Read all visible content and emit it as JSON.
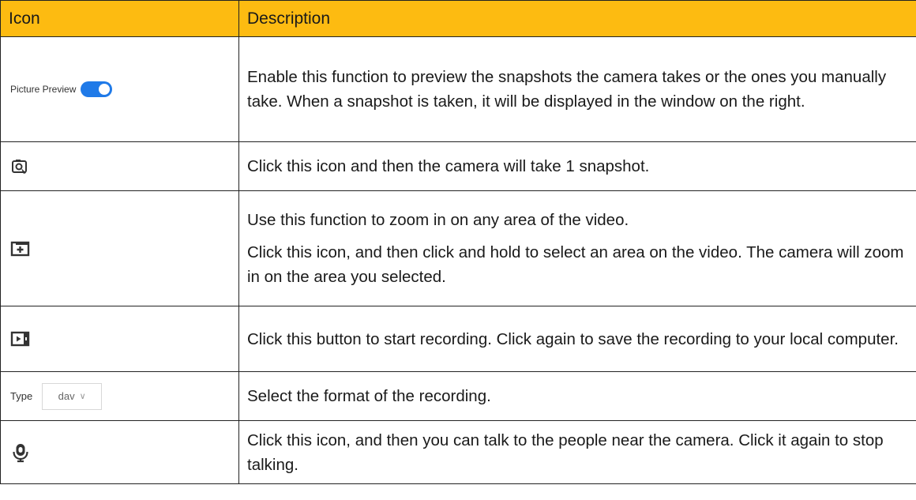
{
  "table": {
    "headers": {
      "icon": "Icon",
      "description": "Description"
    },
    "rows": [
      {
        "icon": "picture-preview-toggle",
        "widget_label": "Picture Preview",
        "widget_state": "on",
        "description": [
          "Enable this function to preview the snapshots the camera takes or the ones you manually take. When a snapshot is taken, it will be displayed in the window on the right."
        ]
      },
      {
        "icon": "snapshot-icon",
        "description": [
          "Click this icon and then the camera will take 1 snapshot."
        ]
      },
      {
        "icon": "zoom-in-icon",
        "description": [
          "Use this function to zoom in on any area of the video.",
          "Click this icon, and then click and hold to select an area on the video. The camera will zoom in on the area you selected."
        ]
      },
      {
        "icon": "record-icon",
        "description": [
          "Click this button to start recording. Click again to save the recording to your local computer."
        ]
      },
      {
        "icon": "type-select",
        "widget_label": "Type",
        "widget_value": "dav",
        "description": [
          "Select the format of the recording."
        ]
      },
      {
        "icon": "talk-microphone-icon",
        "description": [
          "Click this icon, and then you can talk to the people near the camera. Click it again to stop talking."
        ]
      }
    ]
  },
  "colors": {
    "header_bg": "#fdbb11",
    "toggle_on": "#1f7ae8",
    "border": "#222222"
  }
}
